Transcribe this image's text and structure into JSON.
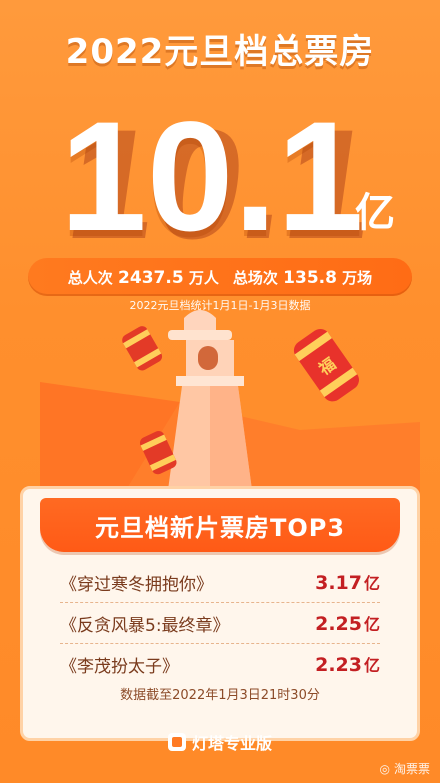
{
  "header": {
    "title": "2022元旦档总票房"
  },
  "headline": {
    "number": "10.1",
    "unit": "亿"
  },
  "stats": {
    "attendance_label": "总人次",
    "attendance_value": "2437.5",
    "attendance_unit": "万人",
    "screenings_label": "总场次",
    "screenings_value": "135.8",
    "screenings_unit": "万场",
    "note": "2022元旦档统计1月1日-1月3日数据"
  },
  "top3": {
    "title": "元旦档新片票房TOP3",
    "rows": [
      {
        "title": "《穿过寒冬拥抱你》",
        "value": "3.17",
        "unit": "亿"
      },
      {
        "title": "《反贪风暴5:最终章》",
        "value": "2.25",
        "unit": "亿"
      },
      {
        "title": "《李茂扮太子》",
        "value": "2.23",
        "unit": "亿"
      }
    ],
    "cutoff": "数据截至2022年1月3日21时30分"
  },
  "brand": {
    "name": "灯塔专业版"
  },
  "watermark": {
    "text": "淘票票"
  },
  "colors": {
    "accent": "#ff6a22",
    "value_red": "#c31f22",
    "panel_bg": "#fff6ec"
  }
}
